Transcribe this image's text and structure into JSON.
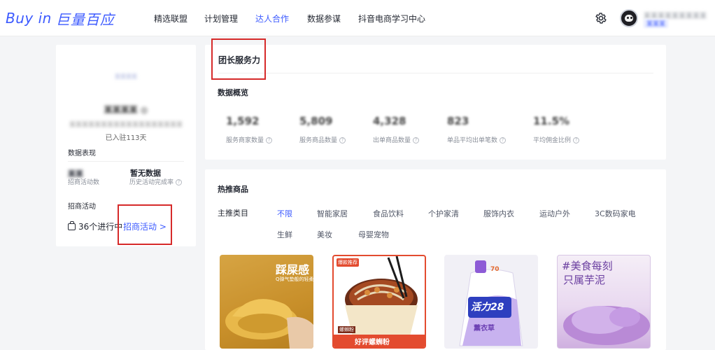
{
  "brand": {
    "latin": "Buy in",
    "cn": "巨量百应"
  },
  "nav": [
    "精选联盟",
    "计划管理",
    "达人合作",
    "数据参谋",
    "抖音电商学习中心"
  ],
  "nav_active": "达人合作",
  "account": {
    "name": "某某某某某某某某某",
    "tag": "某某某"
  },
  "profile": {
    "logo_text": "某某某某",
    "name": "某某某某 ◎",
    "desc": "某某某某某某某某某某某某某某某某某某",
    "days": "已入驻113天",
    "section_perf": "数据表现",
    "metric1_value": "某某",
    "metric1_label": "招商活动数",
    "metric2_value": "暂无数据",
    "metric2_label": "历史活动完成率",
    "section_activity": "招商活动",
    "ongoing": "36个进行中",
    "activity_link": "招商活动 >"
  },
  "overview": {
    "page_title": "团长服务力",
    "section": "数据概览",
    "stats": [
      {
        "value": "1,592",
        "label": "服务商家数量"
      },
      {
        "value": "5,809",
        "label": "服务商品数量"
      },
      {
        "value": "4,328",
        "label": "出单商品数量"
      },
      {
        "value": "823",
        "label": "单品平均出单笔数"
      },
      {
        "value": "11.5%",
        "label": "平均佣金比例"
      }
    ]
  },
  "hot": {
    "title": "热推商品",
    "category_label": "主推类目",
    "categories_row1": [
      "不限",
      "智能家居",
      "食品饮料",
      "个护家清",
      "服饰内衣",
      "运动户外",
      "3C数码家电"
    ],
    "categories_row2": [
      "生鲜",
      "美妆",
      "母婴宠物"
    ],
    "active_category": "不限"
  },
  "products": [
    {
      "headline": "踩屎感",
      "sub": "Q弹气垫般的轻柔"
    },
    {
      "tag": "爆款推荐",
      "caption": "好评螺蛳粉",
      "badge": "螺蛳粉"
    },
    {
      "brand": "活力28",
      "tag": "70",
      "caption": "薰衣草"
    },
    {
      "headline": "#美食每刻",
      "headline2": "只属芋泥"
    }
  ],
  "colors": {
    "accent": "#3d5bff",
    "highlight_box": "#d62a2a"
  }
}
